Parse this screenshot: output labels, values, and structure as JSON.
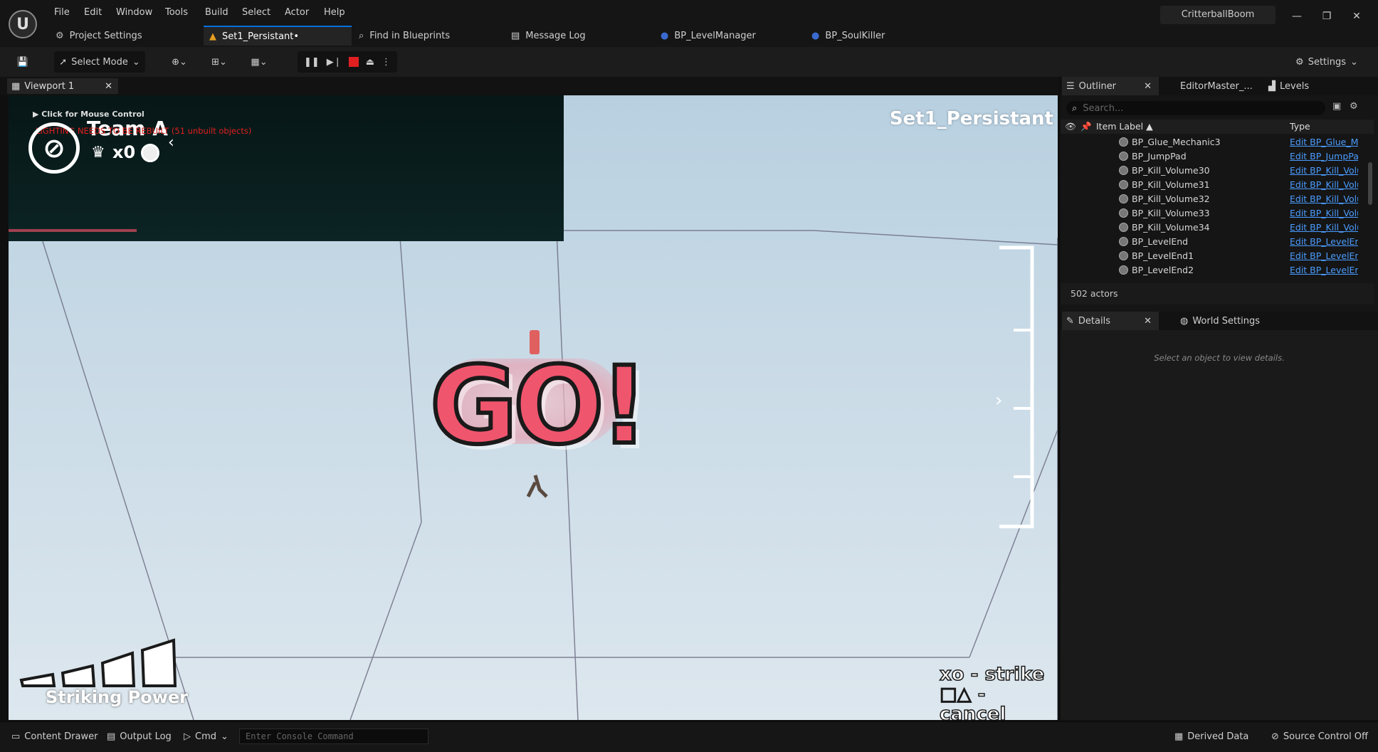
{
  "titlebar": {
    "logo": "U",
    "menu": [
      "File",
      "Edit",
      "Window",
      "Tools",
      "Build",
      "Select",
      "Actor",
      "Help"
    ],
    "project_name": "CritterballBoom",
    "tabs": [
      {
        "label": "Project Settings",
        "icon": "gear-icon"
      },
      {
        "label": "Set1_Persistant•",
        "icon": "level-icon"
      },
      {
        "label": "Find in Blueprints",
        "icon": "search-icon"
      },
      {
        "label": "Message Log",
        "icon": "log-icon"
      },
      {
        "label": "BP_LevelManager",
        "icon": "blueprint-icon"
      },
      {
        "label": "BP_SoulKiller",
        "icon": "blueprint-icon"
      }
    ]
  },
  "toolbar": {
    "select_mode": "Select Mode",
    "settings": "Settings"
  },
  "viewport": {
    "tab_label": "Viewport 1",
    "mouse_control": "Click for Mouse Control",
    "lighting_warning": "LIGHTING NEEDS TO BE REBUILT (51 unbuilt objects)",
    "team": "Team A",
    "count": "x0",
    "level_name": "Set1_Persistant",
    "go_text": "GO!",
    "striking_power": "Striking Power",
    "strike_hint": "xo - strike",
    "cancel_hint": "□△ - cancel"
  },
  "outliner": {
    "tabs": [
      "Outliner",
      "EditorMaster_...",
      "Levels"
    ],
    "search_placeholder": "Search...",
    "col_label": "Item Label ▲",
    "col_type": "Type",
    "rows": [
      {
        "name": "BP_Glue_Mechanic3",
        "type": "Edit BP_Glue_Me"
      },
      {
        "name": "BP_JumpPad",
        "type": "Edit BP_JumpPac"
      },
      {
        "name": "BP_Kill_Volume30",
        "type": "Edit BP_Kill_Volu"
      },
      {
        "name": "BP_Kill_Volume31",
        "type": "Edit BP_Kill_Volu"
      },
      {
        "name": "BP_Kill_Volume32",
        "type": "Edit BP_Kill_Volu"
      },
      {
        "name": "BP_Kill_Volume33",
        "type": "Edit BP_Kill_Volu"
      },
      {
        "name": "BP_Kill_Volume34",
        "type": "Edit BP_Kill_Volu"
      },
      {
        "name": "BP_LevelEnd",
        "type": "Edit BP_LevelEnc"
      },
      {
        "name": "BP_LevelEnd1",
        "type": "Edit BP_LevelEnc"
      },
      {
        "name": "BP_LevelEnd2",
        "type": "Edit BP_LevelEnc"
      }
    ],
    "actor_count": "502 actors"
  },
  "details": {
    "tabs": [
      "Details",
      "World Settings"
    ],
    "empty_message": "Select an object to view details."
  },
  "statusbar": {
    "content_drawer": "Content Drawer",
    "output_log": "Output Log",
    "cmd": "Cmd",
    "console_placeholder": "Enter Console Command",
    "derived_data": "Derived Data",
    "source_control": "Source Control Off"
  }
}
